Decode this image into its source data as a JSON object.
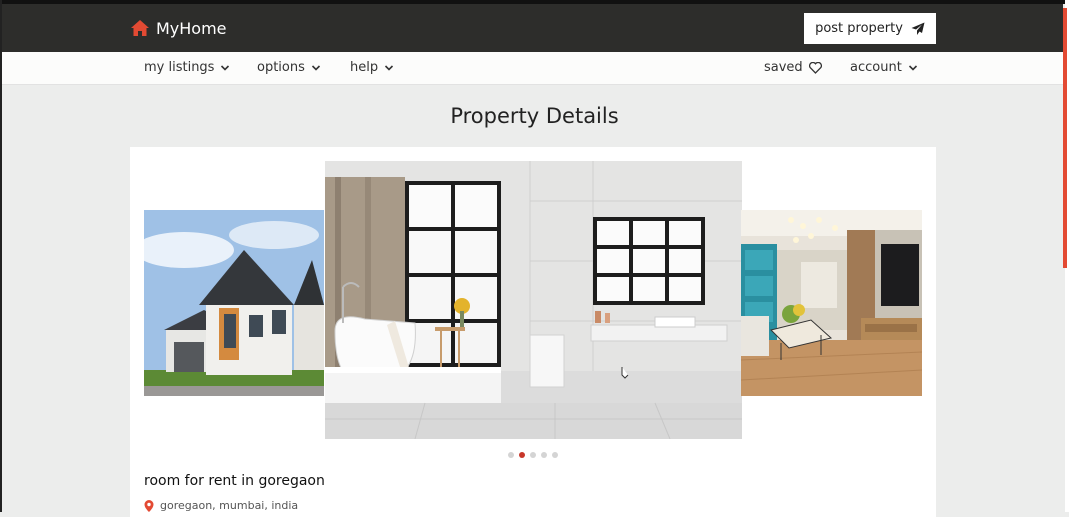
{
  "brand": {
    "name": "MyHome",
    "icon": "home-icon",
    "accent": "#e34a33"
  },
  "header": {
    "post_label": "post property",
    "post_icon": "send-icon"
  },
  "nav": {
    "left": [
      {
        "label": "my listings"
      },
      {
        "label": "options"
      },
      {
        "label": "help"
      }
    ],
    "saved_label": "saved",
    "account_label": "account"
  },
  "page": {
    "title": "Property Details"
  },
  "carousel": {
    "slides": [
      "house-exterior-image",
      "bathroom-image",
      "living-room-image"
    ],
    "dot_count": 5,
    "active_index": 1
  },
  "property": {
    "title": "room for rent in goregaon",
    "location": "goregaon, mumbai, india"
  }
}
